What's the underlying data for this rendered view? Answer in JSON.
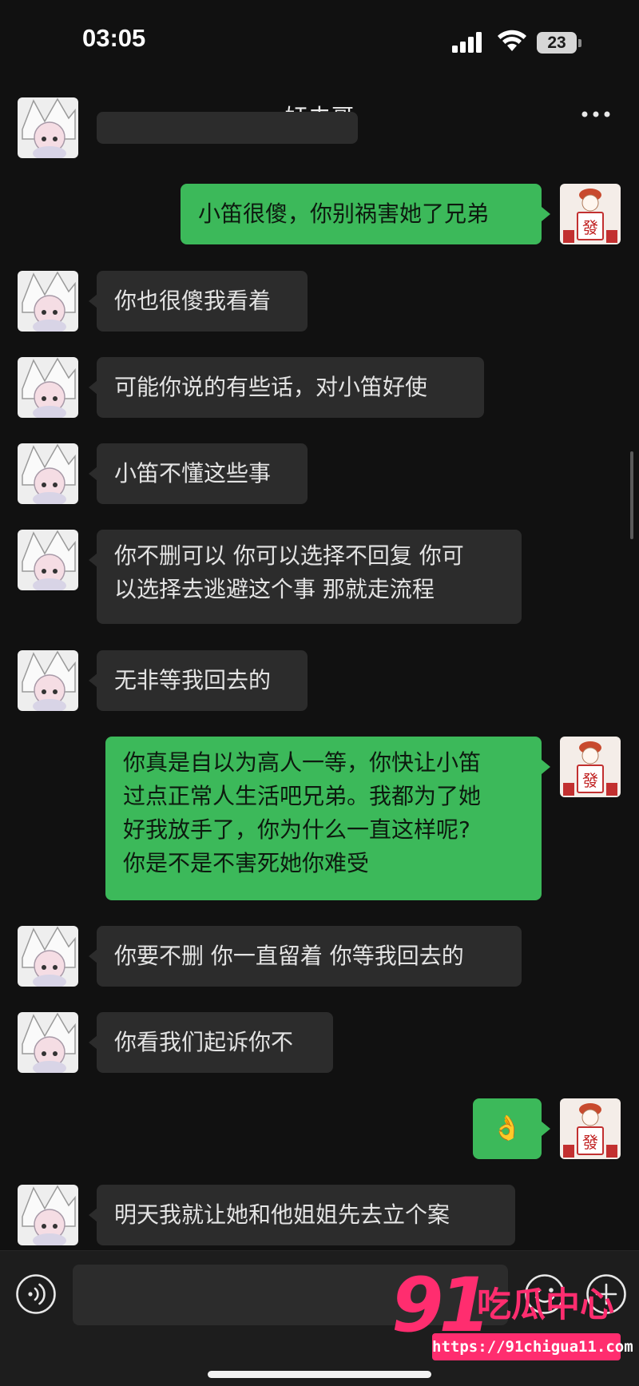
{
  "status_bar": {
    "time": "03:05",
    "battery": "23"
  },
  "chat": {
    "title": "奸夫哥"
  },
  "messages": [
    {
      "side": "in",
      "text": ""
    },
    {
      "side": "out",
      "text": "小笛很傻，你别祸害她了兄弟"
    },
    {
      "side": "in",
      "text": "你也很傻我看着"
    },
    {
      "side": "in",
      "text": "可能你说的有些话，对小笛好使"
    },
    {
      "side": "in",
      "text": "小笛不懂这些事"
    },
    {
      "side": "in",
      "lines": [
        "你不删可以 你可以选择不回复 你可",
        "以选择去逃避这个事 那就走流程"
      ]
    },
    {
      "side": "in",
      "text": "无非等我回去的"
    },
    {
      "side": "out",
      "lines": [
        "你真是自以为高人一等，你快让小笛",
        "过点正常人生活吧兄弟。我都为了她",
        "好我放手了，你为什么一直这样呢?",
        "你是不是不害死她你难受"
      ]
    },
    {
      "side": "in",
      "text": "你要不删 你一直留着 你等我回去的"
    },
    {
      "side": "in",
      "text": "你看我们起诉你不"
    },
    {
      "side": "out",
      "text": "👌"
    },
    {
      "side": "in",
      "text": "明天我就让她和他姐姐先去立个案"
    }
  ],
  "input": {
    "value": ""
  },
  "watermark": {
    "number": "91",
    "name": "吃瓜中心",
    "url": "https://91chigua11.com"
  },
  "icons": {
    "back": "chevron-left-icon",
    "more": "more-dots-icon",
    "voice": "voice-icon",
    "emoji": "emoji-icon",
    "add": "plus-icon"
  },
  "colors": {
    "background": "#111111",
    "incoming_bubble": "#2c2c2c",
    "outgoing_bubble": "#3cb95a",
    "watermark": "#ff2d6f"
  }
}
